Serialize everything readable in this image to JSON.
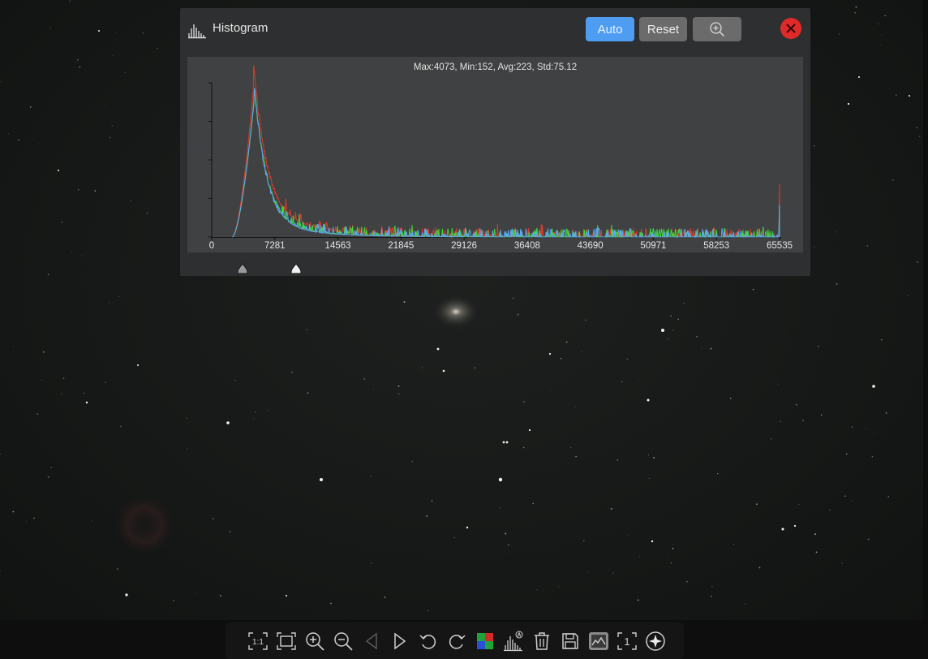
{
  "histogram": {
    "title": "Histogram",
    "buttons": {
      "auto": "Auto",
      "reset": "Reset"
    },
    "stats": "Max:4073, Min:152, Avg:223, Std:75.12",
    "x_ticks": [
      "0",
      "7281",
      "14563",
      "21845",
      "29126",
      "36408",
      "43690",
      "50971",
      "58253",
      "65535"
    ],
    "colors": {
      "red": "#e0392a",
      "green": "#3fd83a",
      "blue": "#5ea8ef",
      "accent": "#4f9df2",
      "close": "#e02a2a"
    }
  },
  "chart_data": {
    "type": "line",
    "x_range": [
      0,
      65535
    ],
    "x_ticks": [
      0,
      7281,
      14563,
      21845,
      29126,
      36408,
      43690,
      50971,
      58253,
      65535
    ],
    "series": [
      {
        "color": "#e0392a",
        "peak_x": 4800,
        "peak_rel": 1.0,
        "tail_rel": 0.22
      },
      {
        "color": "#3fd83a",
        "peak_x": 4900,
        "peak_rel": 0.92,
        "tail_rel": 0.12
      },
      {
        "color": "#5ea8ef",
        "peak_x": 4900,
        "peak_rel": 0.94,
        "tail_rel": 0.1
      }
    ],
    "levels": {
      "black_point_x": 3600,
      "white_point_x": 9800
    }
  },
  "toolbar": {
    "items": [
      "fit-1to1",
      "fit-window",
      "zoom-in",
      "zoom-out",
      "previous",
      "next",
      "rotate-left",
      "rotate-right",
      "debayer",
      "auto-stretch-histogram",
      "delete",
      "save",
      "image-stats",
      "frame-number",
      "star-detection"
    ],
    "frame_label": "1",
    "ratio_label": "1:1"
  }
}
